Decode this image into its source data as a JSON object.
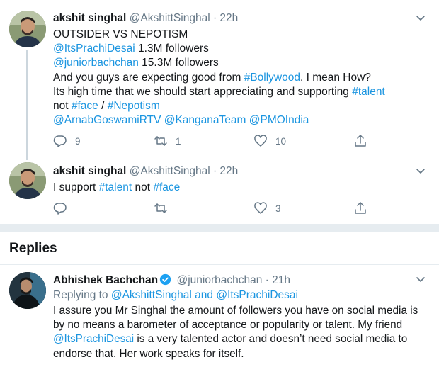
{
  "tweets": [
    {
      "name": "akshit singhal",
      "handle": "@AkshittSinghal",
      "time": "· 22h",
      "lines": {
        "l1": "OUTSIDER VS NEPOTISM",
        "l2_mention": "@ItsPrachiDesai",
        "l2_text": " 1.3M followers",
        "l3_mention": "@juniorbachchan",
        "l3_text": " 15.3M followers",
        "l4_text": "And you guys are expecting good from ",
        "l4_tag": "#Bollywood",
        "l4_text2": ". I mean How?",
        "l5_text": "Its high time that we should start appreciating and supporting ",
        "l5_tag": "#talent",
        "l6_text": "not ",
        "l6_tag1": "#face",
        "l6_sep": " / ",
        "l6_tag2": "#Nepotism",
        "l7_m1": "@ArnabGoswamiRTV",
        "l7_m2": "@KanganaTeam",
        "l7_m3": "@PMOIndia"
      },
      "reply_count": "9",
      "retweet_count": "1",
      "like_count": "10"
    },
    {
      "name": "akshit singhal",
      "handle": "@AkshittSinghal",
      "time": "· 22h",
      "text1": "I support ",
      "tag1": "#talent",
      "text2": " not ",
      "tag2": "#face",
      "reply_count": "",
      "retweet_count": "",
      "like_count": "3"
    }
  ],
  "replies_heading": "Replies",
  "reply": {
    "name": "Abhishek Bachchan",
    "handle": "@juniorbachchan",
    "time": "· 21h",
    "replying_to_label": "Replying to ",
    "replying_to_m1": "@AkshittSinghal",
    "replying_to_and": " and ",
    "replying_to_m2": "@ItsPrachiDesai",
    "l1": "I assure you Mr Singhal the amount of followers you have on social media is",
    "l2": "by no means a barometer of acceptance or popularity or talent. My friend",
    "l3_mention": "@ItsPrachiDesai",
    "l3_text": " is a very talented actor and doesn’t need social media to",
    "l4": "endorse that. Her work speaks for itself."
  },
  "colors": {
    "link": "#1b95e0",
    "muted": "#657786",
    "divider": "#e6ecf0",
    "verified": "#1da1f2"
  }
}
